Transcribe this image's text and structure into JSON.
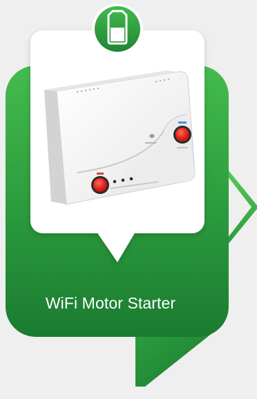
{
  "card": {
    "title": "WiFi Motor Starter"
  },
  "icons": {
    "top_badge": "tank-icon",
    "side_arrow": "chevron-right-icon",
    "device_image": "motor-starter-device"
  },
  "colors": {
    "background": "#efefef",
    "green_light": "#4fc356",
    "green_mid": "#2c9a3d",
    "green_dark": "#1b7a31",
    "white": "#ffffff",
    "indicator_red": "#e2231a"
  }
}
